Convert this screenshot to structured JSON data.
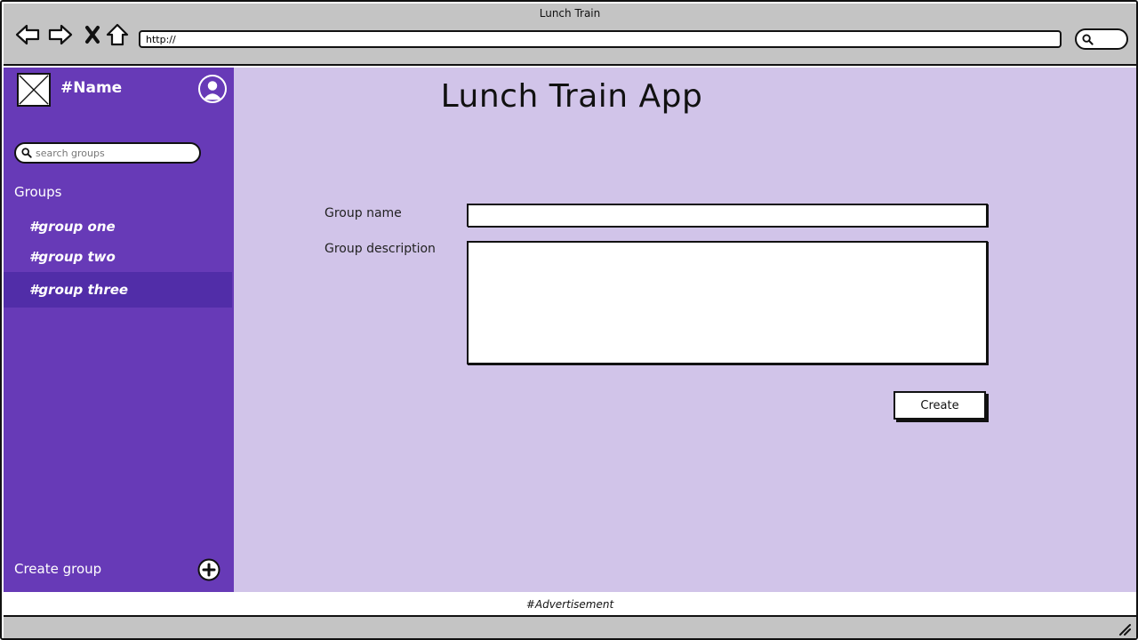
{
  "window": {
    "title": "Lunch Train"
  },
  "browser": {
    "url": "http://",
    "icons": [
      "back-arrow-icon",
      "forward-arrow-icon",
      "close-x-icon",
      "home-icon",
      "search-icon"
    ]
  },
  "sidebar": {
    "workspace_name": "#Name",
    "search_placeholder": "search groups",
    "groups_heading": "Groups",
    "groups": [
      {
        "label": "#group one",
        "active": false
      },
      {
        "label": "#group two",
        "active": false
      },
      {
        "label": "#group three",
        "active": true
      }
    ],
    "create_group_label": "Create group"
  },
  "main": {
    "title": "Lunch Train App",
    "form": {
      "name_label": "Group name",
      "name_value": "",
      "description_label": "Group description",
      "description_value": "",
      "submit_label": "Create"
    }
  },
  "footer": {
    "ad_text": "#Advertisement"
  },
  "colors": {
    "sidebar": "#673ab7",
    "sidebar_active": "#512da8",
    "main_background": "#d1c4e9",
    "chrome": "#c4c4c4"
  }
}
